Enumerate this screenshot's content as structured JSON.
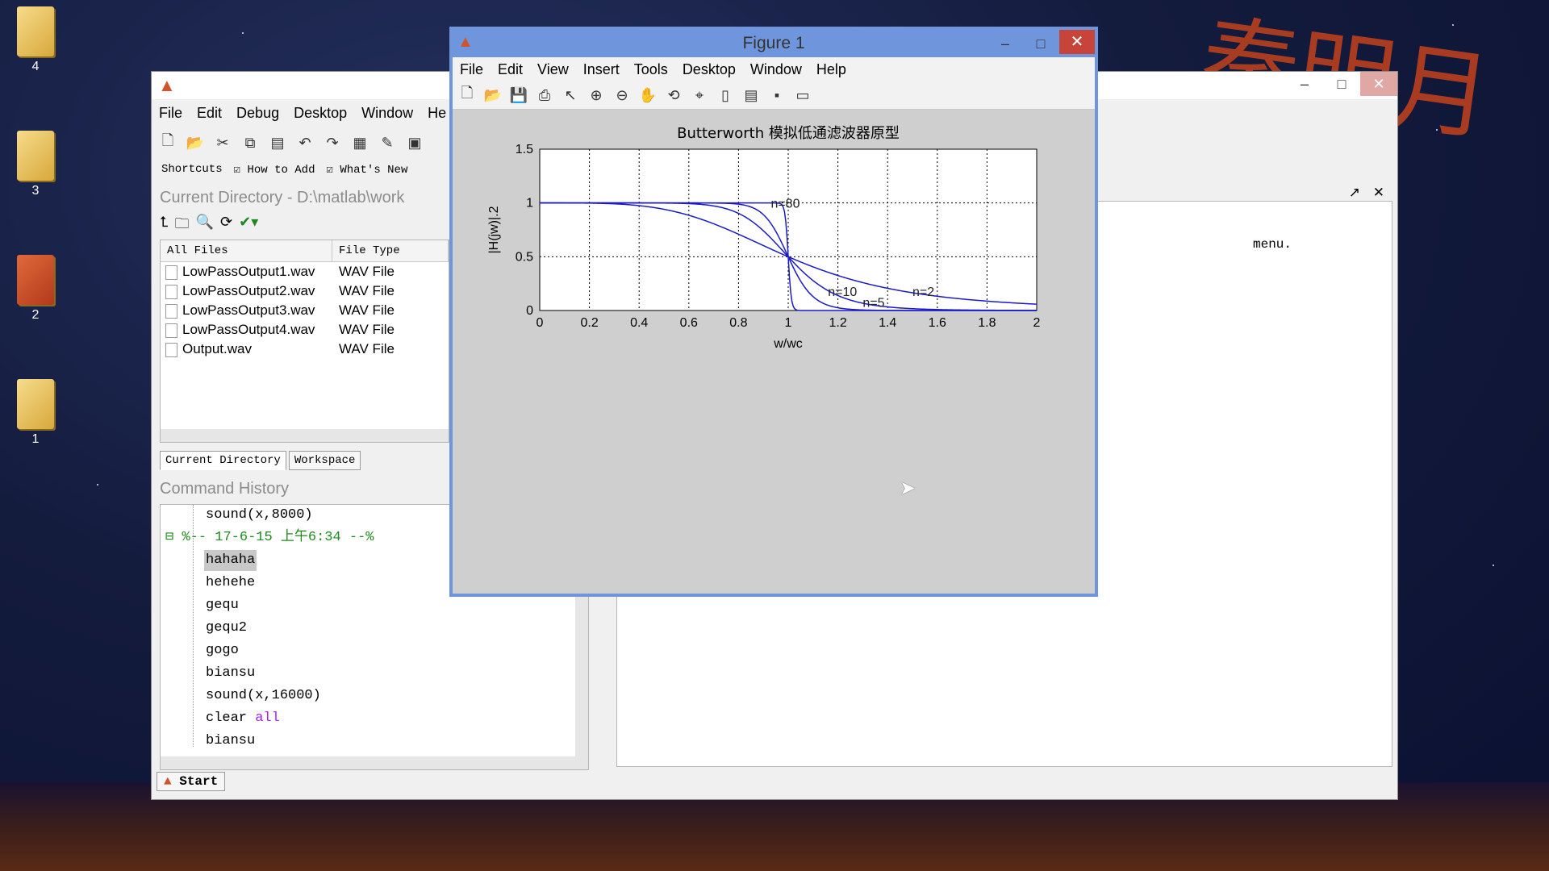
{
  "desktop": {
    "icons": [
      {
        "label": "4"
      },
      {
        "label": "3"
      },
      {
        "label": "2"
      },
      {
        "label": "1"
      }
    ]
  },
  "main": {
    "menu": [
      "File",
      "Edit",
      "Debug",
      "Desktop",
      "Window",
      "He"
    ],
    "shortcuts": {
      "label": "Shortcuts",
      "items": [
        "How to Add",
        "What's New"
      ]
    },
    "current_directory_title": "Current Directory - D:\\matlab\\work",
    "files": {
      "columns": [
        "All Files",
        "File Type"
      ],
      "rows": [
        {
          "name": "LowPassOutput1.wav",
          "type": "WAV File"
        },
        {
          "name": "LowPassOutput2.wav",
          "type": "WAV File"
        },
        {
          "name": "LowPassOutput3.wav",
          "type": "WAV File"
        },
        {
          "name": "LowPassOutput4.wav",
          "type": "WAV File"
        },
        {
          "name": "Output.wav",
          "type": "WAV File"
        }
      ]
    },
    "tabs": [
      "Current Directory",
      "Workspace"
    ],
    "command_history_title": "Command History",
    "history": [
      {
        "text": "sound(x,8000)",
        "style": "normal"
      },
      {
        "text": "%-- 17-6-15 上午6:34 --%",
        "style": "green"
      },
      {
        "text": "hahaha",
        "style": "selected"
      },
      {
        "text": "hehehe",
        "style": "normal"
      },
      {
        "text": "gequ",
        "style": "normal"
      },
      {
        "text": "gequ2",
        "style": "normal"
      },
      {
        "text": "gogo",
        "style": "normal"
      },
      {
        "text": "biansu",
        "style": "normal"
      },
      {
        "text": "sound(x,16000)",
        "style": "normal"
      },
      {
        "text_cmd": "clear",
        "text_kw": "all",
        "style": "keyword"
      },
      {
        "text": "biansu",
        "style": "normal"
      }
    ],
    "command_window_text": "menu.",
    "start_label": "Start"
  },
  "figure": {
    "title": "Figure 1",
    "menu": [
      "File",
      "Edit",
      "View",
      "Insert",
      "Tools",
      "Desktop",
      "Window",
      "Help"
    ]
  },
  "chart_data": {
    "type": "line",
    "title": "Butterworth 模拟低通滤波器原型",
    "xlabel": "w/wc",
    "ylabel": "|H(jw)|.2",
    "xlim": [
      0,
      2
    ],
    "ylim": [
      0,
      1.5
    ],
    "xticks": [
      "0",
      "0.2",
      "0.4",
      "0.6",
      "0.8",
      "1",
      "1.2",
      "1.4",
      "1.6",
      "1.8",
      "2"
    ],
    "yticks": [
      "0",
      "0.5",
      "1",
      "1.5"
    ],
    "grid": true,
    "series": [
      {
        "name": "n=2",
        "order": 2
      },
      {
        "name": "n=5",
        "order": 5
      },
      {
        "name": "n=10",
        "order": 10
      },
      {
        "name": "n=80",
        "order": 80
      }
    ],
    "annotations": [
      {
        "text": "n=80",
        "x": 0.93,
        "y": 1.0
      },
      {
        "text": "n=10",
        "x": 1.16,
        "y": 0.18
      },
      {
        "text": "n=5",
        "x": 1.3,
        "y": 0.08
      },
      {
        "text": "n=2",
        "x": 1.5,
        "y": 0.18
      }
    ],
    "color": "#1a1ac8"
  }
}
